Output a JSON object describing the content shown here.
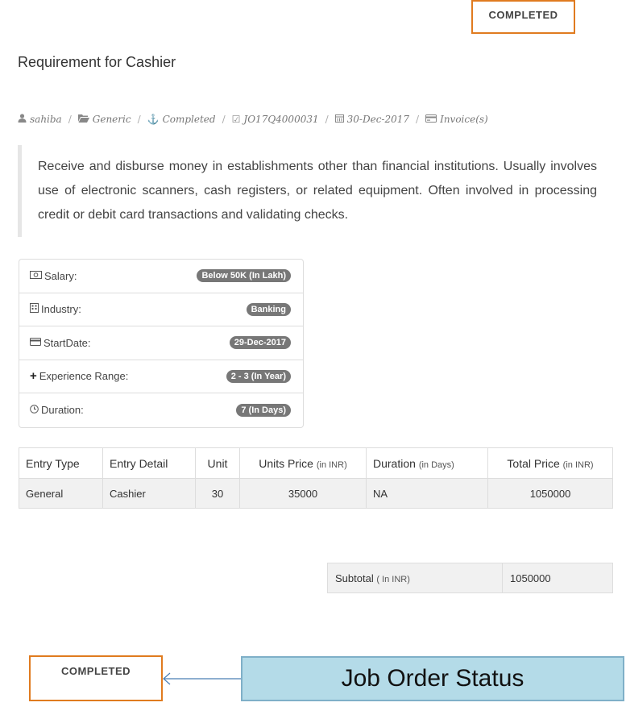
{
  "status_top": "COMPLETED",
  "page_title": "Requirement for Cashier",
  "meta": {
    "user": "sahiba",
    "category": "Generic",
    "status": "Completed",
    "job_id": "JO17Q4000031",
    "date": "30-Dec-2017",
    "invoice": "Invoice(s)",
    "icons": [
      "user-icon",
      "folder-open-icon",
      "anchor-icon",
      "check-square-icon",
      "calendar-icon",
      "credit-card-icon"
    ]
  },
  "description": "Receive and disburse money in establishments other than financial institutions. Usually involves use of electronic scanners, cash registers, or related equipment. Often involved in processing credit or debit card transactions and validating checks.",
  "details": {
    "salary_label": "Salary:",
    "salary_value": "Below 50K  (In Lakh)",
    "industry_label": "Industry:",
    "industry_value": "Banking",
    "startdate_label": "StartDate:",
    "startdate_value": "29-Dec-2017",
    "experience_label": "Experience Range:",
    "experience_value": "2 - 3  (In Year)",
    "duration_label": "Duration:",
    "duration_value": "7  (In Days)"
  },
  "entries": {
    "headers": {
      "entry_type": "Entry Type",
      "entry_detail": "Entry Detail",
      "unit": "Unit",
      "units_price": "Units Price",
      "units_price_note": "(in INR)",
      "duration": "Duration",
      "duration_note": "(in Days)",
      "total_price": "Total Price",
      "total_price_note": "(in INR)"
    },
    "rows": [
      {
        "entry_type": "General",
        "entry_detail": "Cashier",
        "unit": "30",
        "units_price": "35000",
        "duration": "NA",
        "total_price": "1050000"
      }
    ]
  },
  "subtotal": {
    "label": "Subtotal",
    "note": "( In INR)",
    "value": "1050000"
  },
  "status_bottom": "COMPLETED",
  "callout": "Job Order Status",
  "colors": {
    "status_border": "#e07b1f",
    "callout_bg": "#b4dbe8",
    "callout_border": "#7fb0c8",
    "arrow": "#4a7fb5",
    "pill_bg": "#777777"
  }
}
